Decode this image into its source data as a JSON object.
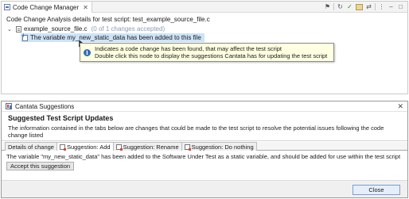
{
  "view": {
    "tab_label": "Code Change Manager",
    "tab_close": "✕",
    "toolbar": [
      "pin-icon",
      "refresh-icon",
      "run-icon",
      "database-icon",
      "sync-icon",
      "menu-icon",
      "minimize-icon",
      "maximize-icon"
    ],
    "heading": "Code Change Analysis details for test script: test_example_source_file.c",
    "tree": {
      "file_node": "example_source_file.c",
      "file_count": "(0 of 1 changes accepted)",
      "change_node": "The variable my_new_static_data has been added to this file"
    },
    "tooltip": {
      "line1": "Indicates a code change has been found, that may affect the test script",
      "line2": "Double click this node to display the suggestions Cantata has for updating the test script"
    }
  },
  "dialog": {
    "title": "Cantata Suggestions",
    "close_glyph": "✕",
    "heading": "Suggested Test Script Updates",
    "description": "The information contained in the tabs below are changes that could be made to the test script to resolve the potential issues following the code change listed",
    "tabs": [
      {
        "label": "Details of change",
        "active": false
      },
      {
        "label": "Suggestion: Add",
        "active": true
      },
      {
        "label": "Suggestion: Rename",
        "active": false
      },
      {
        "label": "Suggestion: Do nothing",
        "active": false
      }
    ],
    "content_text": "The variable \"my_new_static_data\" has been added to the Software Under Test as a static variable, and should be added for use within the test script",
    "accept_button": "Accept this suggestion",
    "close_button": "Close"
  },
  "colors": {
    "selection": "#cde3f7",
    "tooltip_bg": "#ffffe1",
    "accent": "#2f6db5"
  }
}
